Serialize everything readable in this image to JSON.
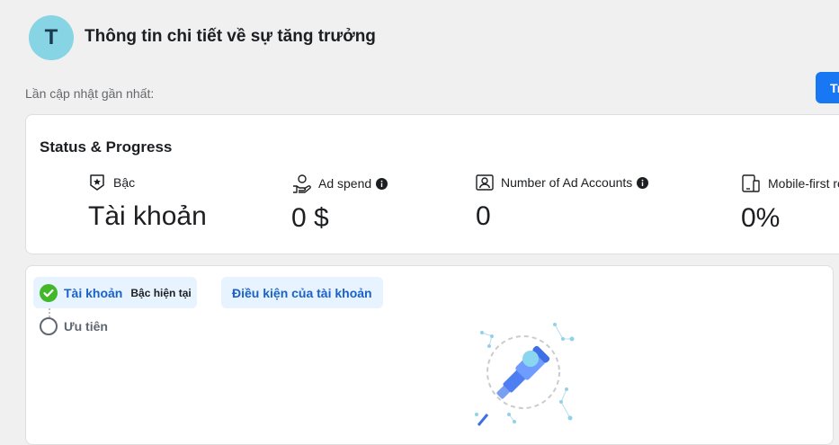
{
  "header": {
    "avatar_letter": "T",
    "title": "Thông tin chi tiết về sự tăng trưởng",
    "last_updated_label": "Lần cập nhật gần nhất:",
    "top_right_button": "Tr"
  },
  "status": {
    "title": "Status & Progress",
    "metrics": [
      {
        "label": "Bậc",
        "value": "Tài khoản",
        "icon": "badge-star-icon"
      },
      {
        "label": "Ad spend",
        "value": "0 $",
        "icon": "hand-money-icon",
        "info": true
      },
      {
        "label": "Number of Ad Accounts",
        "value": "0",
        "icon": "account-id-icon",
        "info": true
      },
      {
        "label": "Mobile-first re",
        "value": "0%",
        "icon": "mobile-devices-icon"
      }
    ]
  },
  "steps": [
    {
      "label": "Tài khoản",
      "badge": "Bậc hiện tại",
      "state": "completed"
    },
    {
      "label": "Ưu tiên",
      "state": "pending"
    }
  ],
  "requirements": {
    "tab_label": "Điều kiện của tài khoản"
  },
  "colors": {
    "accent": "#1877f2",
    "success": "#42b72a",
    "avatar_bg": "#86d4e4",
    "active_tab_bg": "#e7f3ff"
  }
}
